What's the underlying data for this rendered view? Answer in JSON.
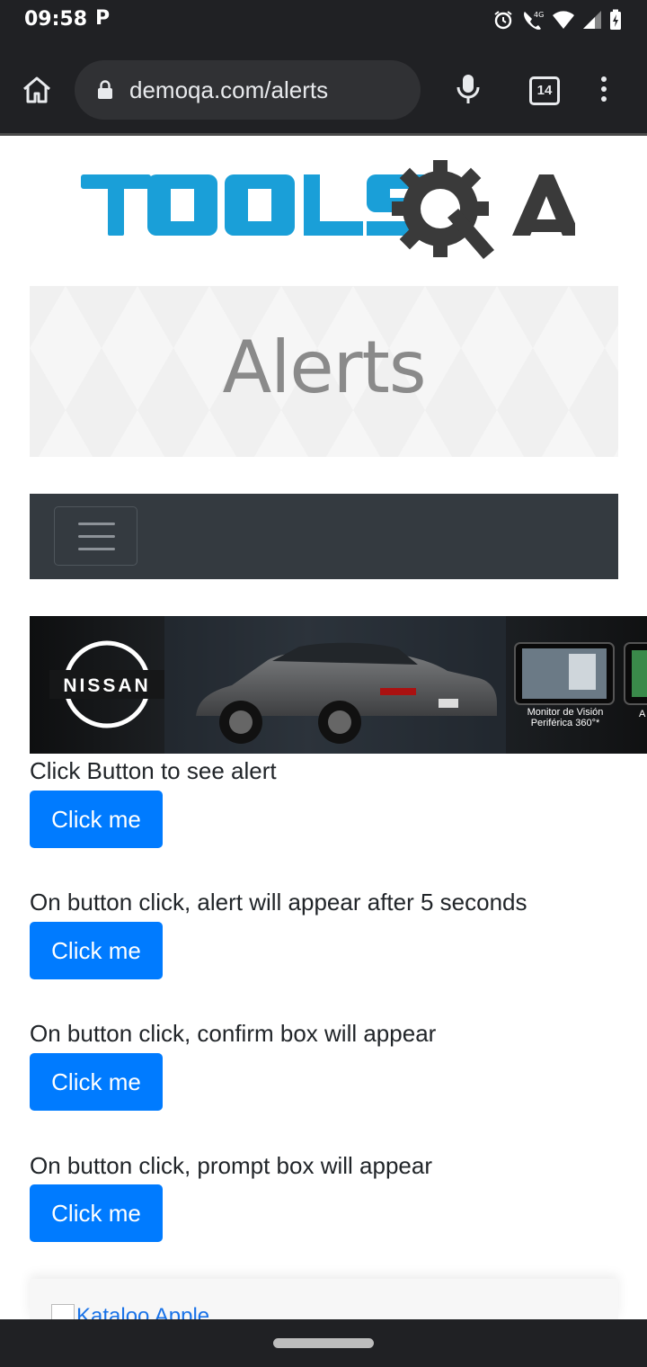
{
  "status_bar": {
    "time": "09:58",
    "notification_icon": "parking-p-icon",
    "right_icons": [
      "alarm-icon",
      "wifi-calling-4g-icon",
      "wifi-icon",
      "signal-icon",
      "battery-charging-icon"
    ]
  },
  "browser": {
    "url": "demoqa.com/alerts",
    "tab_count": "14",
    "icons": [
      "home-icon",
      "lock-icon",
      "mic-icon",
      "tabs-icon",
      "more-menu-icon"
    ]
  },
  "page": {
    "logo_text": "TOOLSQA",
    "title": "Alerts",
    "ad_brand": "NISSAN",
    "ad_caption_line1": "Monitor de Visión",
    "ad_caption_line2": "Periférica 360°*",
    "ad_caption_cut": "A",
    "sections": [
      {
        "label": "Click Button to see alert",
        "button": "Click me"
      },
      {
        "label": "On button click, alert will appear after 5 seconds",
        "button": "Click me"
      },
      {
        "label": "On button click, confirm box will appear",
        "button": "Click me"
      },
      {
        "label": "On button click, prompt box will appear",
        "button": "Click me"
      }
    ],
    "footer_ad_text": "Kataloo Apple"
  },
  "colors": {
    "primary_button": "#007bff",
    "navbar": "#343a40",
    "logo_blue": "#1a9fd8",
    "logo_dark": "#3a3a3a",
    "browser_chrome": "#202124"
  }
}
